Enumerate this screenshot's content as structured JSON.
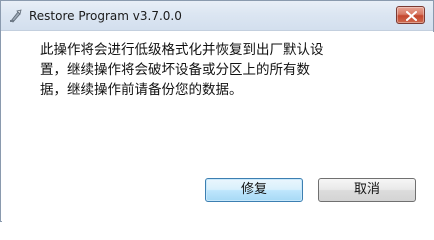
{
  "window": {
    "title": "Restore Program v3.7.0.0",
    "app_icon": "restore-app-icon",
    "close_icon": "close-icon"
  },
  "dialog": {
    "message": "此操作将会进行低级格式化并恢复到出厂默认设\n置，继续操作将会破坏设备或分区上的所有数\n据，继续操作前请备份您的数据。"
  },
  "buttons": {
    "repair_label": "修复",
    "cancel_label": "取消"
  },
  "colors": {
    "accent_border": "#3c7fb1",
    "close_red": "#c4462e"
  }
}
